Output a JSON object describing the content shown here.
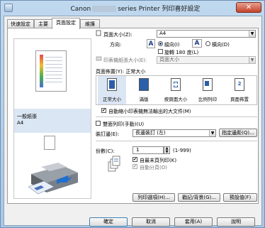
{
  "window": {
    "title_left": "Canon",
    "title_right": "series Printer 列印喜好設定",
    "close": "✕"
  },
  "tabs": [
    "快速設定",
    "主要",
    "頁面設定",
    "維護"
  ],
  "preview": {
    "media_type": "一般紙張",
    "page_size": "A4"
  },
  "page_size": {
    "label": "頁面大小(Z):",
    "value": "A4"
  },
  "orientation": {
    "label": "方向:",
    "portrait_label": "縱向(I)",
    "landscape_label": "橫向(D)",
    "rotate_label": "旋轉 180 度(L)",
    "selected": "portrait"
  },
  "printer_paper_size": {
    "label": "印表機紙張大小(E):",
    "value": "頁面大小"
  },
  "page_layout": {
    "label": "頁面佈置(Y):",
    "current": "正常大小",
    "items": [
      "正常大小",
      "滿版",
      "按頁面大小",
      "比例列印",
      "頁面佈置"
    ]
  },
  "auto_reduce": {
    "label": "自動縮小印表機無法輸出的大文件(M)",
    "checked": true
  },
  "duplex": {
    "label": "雙面列印(手動)(U)",
    "checked": false
  },
  "stapling": {
    "label": "裝訂邊(E):",
    "value": "長邊裝訂 (左)",
    "margin_button": "指定邊距(Q)..."
  },
  "copies": {
    "label": "份數(C):",
    "value": "1",
    "range": "(1-999)",
    "last_page_first": "自最末頁列印(K)",
    "collate": "自動分頁(O)",
    "last_page_first_checked": true,
    "collate_checked": true
  },
  "panel_buttons": {
    "print_options": "列印選項(H)...",
    "stamp_background": "戳記/背景(G)...",
    "defaults": "預設值(F)"
  },
  "dialog_buttons": {
    "ok": "確定",
    "cancel": "取消",
    "apply": "套用(A)",
    "help": "說明"
  },
  "colors": {
    "titlebar": "#bfd8ee",
    "accent": "#2b5fa8",
    "close": "#c6412a"
  }
}
